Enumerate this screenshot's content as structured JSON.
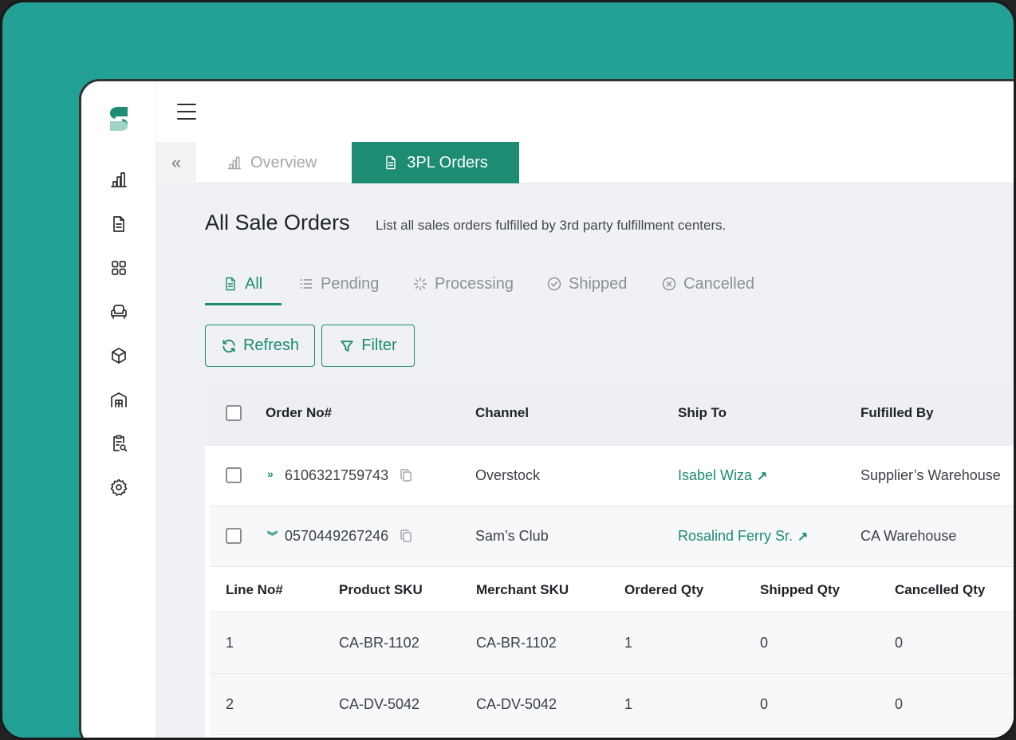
{
  "page_tabs": [
    {
      "label": "Overview",
      "icon": "bar-chart-icon",
      "active": false
    },
    {
      "label": "3PL Orders",
      "icon": "document-icon",
      "active": true
    }
  ],
  "header": {
    "title": "All Sale Orders",
    "subtitle": "List all sales orders fulfilled by 3rd party fulfillment centers."
  },
  "filter_tabs": [
    {
      "label": "All",
      "icon": "document-icon",
      "active": true
    },
    {
      "label": "Pending",
      "icon": "list-icon",
      "active": false
    },
    {
      "label": "Processing",
      "icon": "spinner-icon",
      "active": false
    },
    {
      "label": "Shipped",
      "icon": "check-circle-icon",
      "active": false
    },
    {
      "label": "Cancelled",
      "icon": "x-circle-icon",
      "active": false
    }
  ],
  "actions": {
    "refresh": "Refresh",
    "filter": "Filter"
  },
  "table": {
    "columns": [
      "Order No#",
      "Channel",
      "Ship To",
      "Fulfilled By"
    ],
    "rows": [
      {
        "order_no": "6106321759743",
        "channel": "Overstock",
        "ship_to": "Isabel Wiza",
        "fulfilled_by": "Supplier’s Warehouse",
        "expanded": false
      },
      {
        "order_no": "0570449267246",
        "channel": "Sam’s Club",
        "ship_to": "Rosalind Ferry Sr.",
        "fulfilled_by": "CA Warehouse",
        "expanded": true
      }
    ],
    "line_columns": [
      "Line No#",
      "Product SKU",
      "Merchant SKU",
      "Ordered Qty",
      "Shipped Qty",
      "Cancelled Qty"
    ],
    "lines": [
      {
        "line_no": "1",
        "product_sku": "CA-BR-1102",
        "merchant_sku": "CA-BR-1102",
        "ordered": "1",
        "shipped": "0",
        "cancelled": "0"
      },
      {
        "line_no": "2",
        "product_sku": "CA-DV-5042",
        "merchant_sku": "CA-DV-5042",
        "ordered": "1",
        "shipped": "0",
        "cancelled": "0"
      }
    ]
  },
  "colors": {
    "accent": "#1d8c73",
    "frame": "#22a093"
  }
}
